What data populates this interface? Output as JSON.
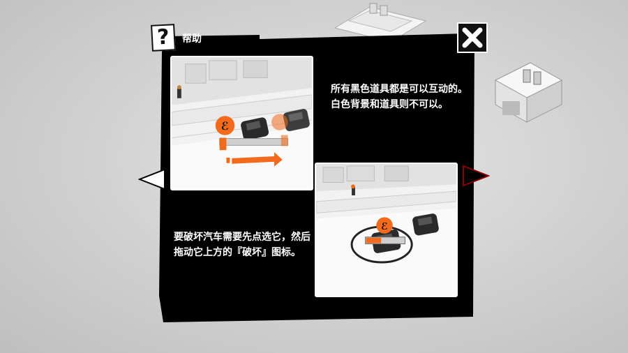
{
  "dialog": {
    "title": "帮助",
    "help_glyph": "?",
    "close_icon": "close-x-icon"
  },
  "tips": [
    {
      "text": "所有黑色道具都是可以互动的。白色背景和道具则不可以。"
    },
    {
      "text": "要破坏汽车需要先点选它，然后拖动它上方的『破坏』图标。"
    }
  ],
  "navigation": {
    "prev_icon": "arrow-left-icon",
    "next_icon": "arrow-right-icon"
  },
  "colors": {
    "panel": "#000000",
    "accent_orange": "#f26a1b",
    "next_arrow": "#8b0000"
  }
}
